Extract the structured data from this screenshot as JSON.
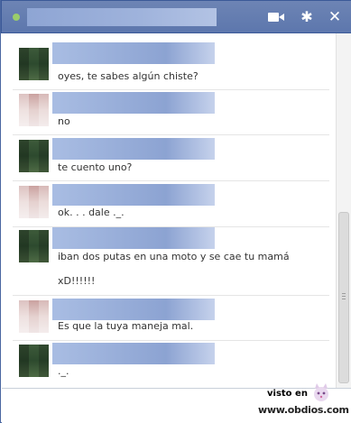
{
  "window": {
    "status_color": "#9acd6b",
    "accent": "#6d84b4",
    "icons": [
      "video-icon",
      "gear-icon",
      "close-icon"
    ],
    "gear_glyph": "✱",
    "close_glyph": "✕"
  },
  "messages": [
    {
      "avatar": "green",
      "text": "oyes, te sabes algún chiste?"
    },
    {
      "avatar": "pink",
      "text": "no"
    },
    {
      "avatar": "green",
      "text": "te cuento uno?"
    },
    {
      "avatar": "pink",
      "text": "ok. . . dale ._."
    },
    {
      "avatar": "green",
      "text": "iban dos putas en una moto y se cae tu mamá",
      "text2": "xD!!!!!!"
    },
    {
      "avatar": "pink",
      "text": "Es que la tuya maneja mal."
    },
    {
      "avatar": "green",
      "text": "._."
    }
  ],
  "watermark": {
    "visto_label": "visto en",
    "url": "www.obdios.com"
  }
}
